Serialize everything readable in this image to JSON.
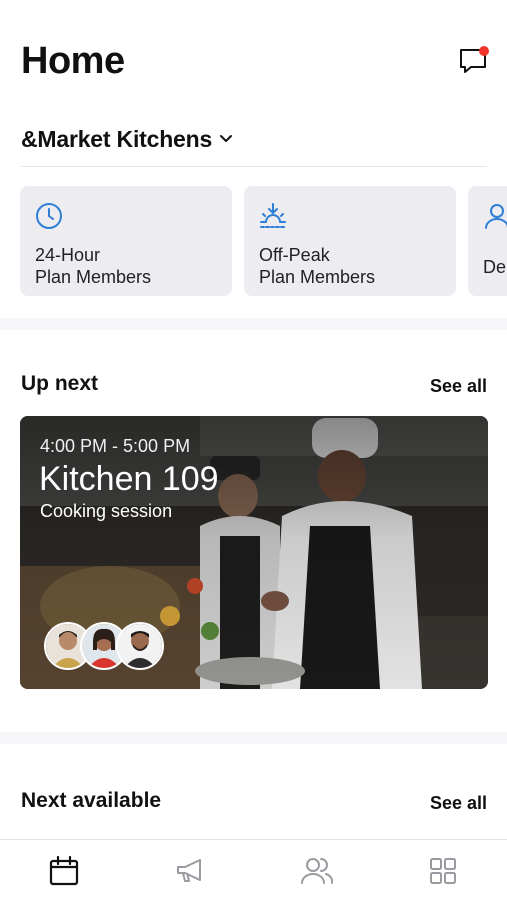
{
  "header": {
    "title": "Home"
  },
  "location": {
    "name": "&Market Kitchens"
  },
  "plan_cards": [
    {
      "icon": "clock-icon",
      "line1": "24-Hour",
      "line2": "Plan Members"
    },
    {
      "icon": "sunrise-icon",
      "line1": "Off-Peak",
      "line2": "Plan Members"
    },
    {
      "icon": "person-icon",
      "line1": "De",
      "line2": ""
    }
  ],
  "up_next": {
    "title": "Up next",
    "see_all": "See all",
    "event": {
      "time": "4:00 PM - 5:00 PM",
      "name": "Kitchen 109",
      "type": "Cooking session"
    }
  },
  "next_available": {
    "title": "Next available",
    "see_all": "See all"
  },
  "tabbar": {
    "items": [
      "calendar-icon",
      "megaphone-icon",
      "people-icon",
      "grid-icon"
    ]
  },
  "colors": {
    "accent": "#2f7fd6",
    "notification": "#f2362b",
    "card_bg": "#ececf1"
  }
}
